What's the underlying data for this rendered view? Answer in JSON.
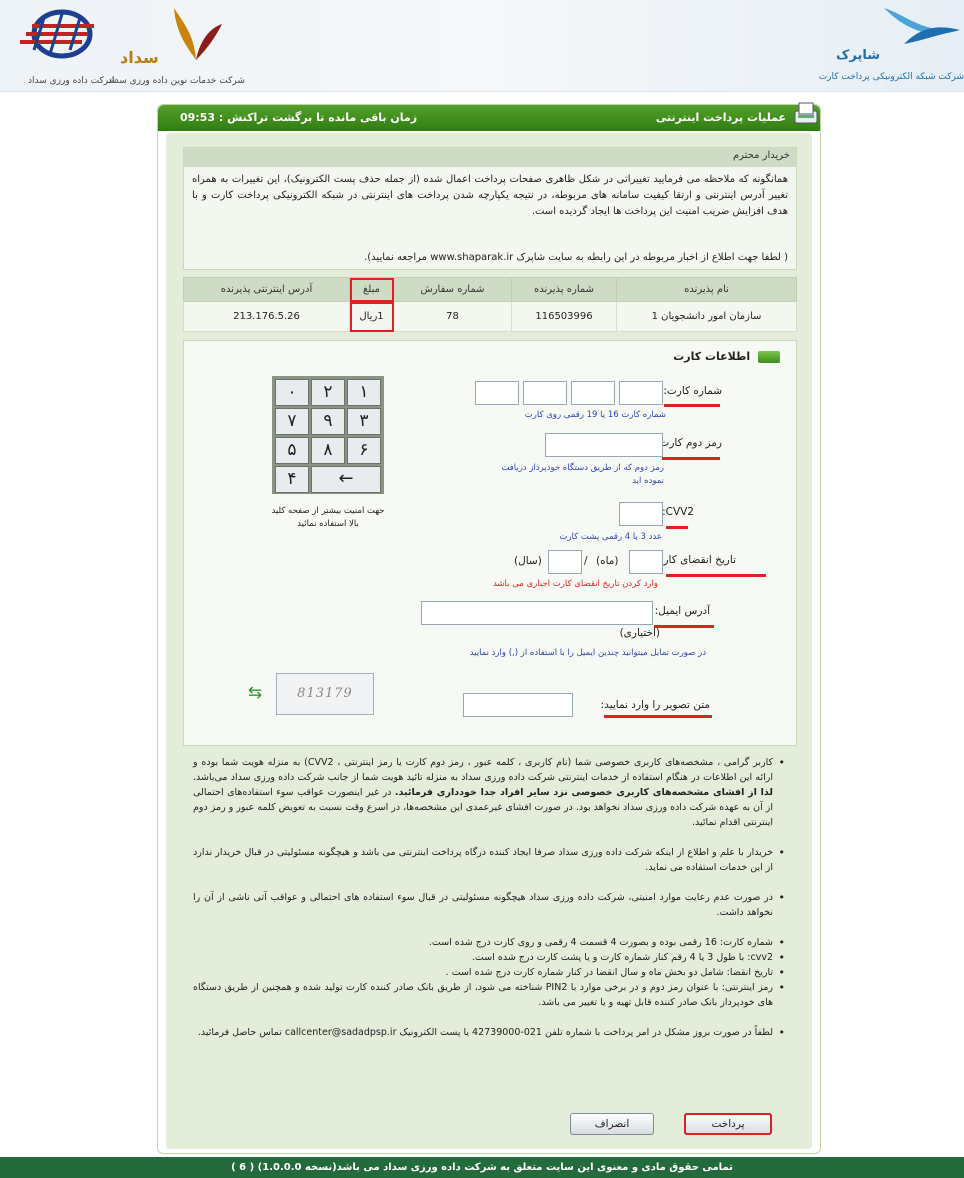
{
  "header": {
    "shaparak_name": "شاپرک",
    "shaparak_caption": "شرکت شبکه الکترونیکی پرداخت کارت",
    "sadad_name": "سداد",
    "sadad_caption": "شرکت خدمات نوین داده ورزی سداد",
    "datavarzi_caption": "شرکت داده ورزی سداد"
  },
  "topbar": {
    "title": "عملیات پرداخت اینترنتی",
    "timer_label": "زمان باقی مانده تا برگشت تراکنش :",
    "timer_value": "09:53"
  },
  "notice": {
    "heading": "خریدار محترم",
    "body": "همانگونه که ملاحظه می فرمایید تغییراتی در شکل ظاهری صفحات پرداخت اعمال شده (از جمله حذف پست الکترونیک)، این تغییرات به همراه تغییر آدرس اینترنتی و ارتقا کیفیت سامانه های مربوطه، در نتیجه یکپارچه شدن پرداخت های اینترنتی در شبکه الکترونیکی پرداخت کارت و با هدف افزایش ضریب امنیت این پرداخت ها ایجاد گردیده است.",
    "footer": "( لطفا جهت اطلاع از اخبار مربوطه در این رابطه به سایت شاپرک www.shaparak.ir مراجعه نمایید)."
  },
  "merchant_table": {
    "headers": [
      "نام پذیرنده",
      "شماره پذیرنده",
      "شماره سفارش",
      "مبلغ",
      "آدرس اینترنتی پذیرنده"
    ],
    "row": [
      "سازمان امور دانشجویان 1",
      "116503996",
      "78",
      "1ریال",
      "213.176.5.26"
    ]
  },
  "card_form": {
    "section_title": "اطلاعات کارت",
    "card_number_label": "شماره کارت:",
    "card_number_hint": "شماره کارت 16 یا 19 رقمی روی کارت",
    "pin2_label": "رمز دوم کارت:",
    "pin2_hint": "رمز دوم که از طریق دستگاه خودپرداز دریافت نموده اید",
    "cvv2_label": "CVV2:",
    "cvv2_hint": "عدد 3 یا 4 رقمی پشت کارت",
    "expiry_label": "تاریخ انقضای کارت:",
    "expiry_month": "(ماه)",
    "expiry_sep": "/",
    "expiry_year": "(سال)",
    "expiry_hint": "وارد کردن تاریخ انقضای کارت اجباری می باشد",
    "email_label": "آدرس ایمیل:",
    "email_optional": "(اختیاری)",
    "email_hint": "در صورت تمایل میتوانید چندین ایمیل را با استفاده از (,) وارد نمایید",
    "captcha_label": "متن تصویر را وارد نمایید:",
    "captcha_text": "813179",
    "keypad_keys": [
      "۱",
      "۲",
      "۰",
      "۳",
      "۹",
      "۷",
      "۶",
      "۸",
      "۵"
    ],
    "keypad_last": "۴",
    "keypad_back": "←",
    "keypad_note": "جهت امنیت بیشتر از صفحه کلید بالا استفاده نمائید"
  },
  "rules": {
    "r1_a": "کاربر گرامی ، مشخصه‌های کاربری خصوصی شما (نام کاربری ، کلمه عبور ، رمز دوم کارت یا رمز اینترنتی ، CVV2) به منزله هویت شما بوده و ارائه این اطلاعات در هنگام استفاده از خدمات اینترنتی شرکت داده ورزی سداد به منزله تائید هویت شما از جانب شرکت داده ورزی سداد می‌باشد.",
    "r1_b": "لذا از افشای مشخصه‌های کاربری خصوصی نزد سایر افراد جدا خودداری فرمائید.",
    "r1_c": "در غیر اینصورت عواقب سوء استفاده‌های احتمالی از آن به عهده شرکت داده ورزی سداد نخواهد بود. در صورت افشای غیرعمدی این مشخصه‌ها، در اسرع وقت نسبت به تعویض کلمه عبور و رمز دوم اینترنتی اقدام نمائید.",
    "r2": "خریدار با علم و اطلاع از اینکه شرکت داده ورزی سداد صرفا ایجاد کننده درگاه پرداخت اینترنتی می باشد و هیچگونه مسئولیتی در قبال خریدار ندارد از این خدمات استفاده می نماید.",
    "r3": "در صورت عدم رعایت موارد امنیتی، شرکت داده ورزی سداد هیچگونه مسئولیتی در قبال سوء استفاده های احتمالی و عواقب آتی ناشی از آن را نخواهد داشت.",
    "r4": "شماره کارت: 16 رقمی بوده و بصورت 4 قسمت 4 رقمی و روی کارت درج شده است.",
    "r5": "cvv2: با طول 3 یا 4 رقم کنار شماره کارت و یا پشت کارت درج شده است.",
    "r6": "تاریخ انقضا: شامل دو بخش ماه و سال انقضا در کنار شماره کارت درج شده است .",
    "r7": "رمز اینترنتی: با عنوان رمز دوم و در برخی موارد با PIN2 شناخته می شود، از طریق بانک صادر کننده کارت تولید شده و همچنین از طریق دستگاه های خودپرداز بانک صادر کننده قابل تهیه و یا تغییر می باشد.",
    "r8": "لطفاً در صورت بروز مشکل در امر پرداخت با شماره تلفن 021-42739000 یا پست الکترونیک callcenter@sadadpsp.ir تماس حاصل فرمائید."
  },
  "buttons": {
    "pay": "پرداخت",
    "cancel": "انصراف"
  },
  "footer": {
    "text": "تمامی حقوق مادی و معنوی این سایت متعلق به شرکت داده ورزی سداد می باشد(نسخه 1.0.0.0) ( 6 )"
  },
  "colors": {
    "accent_green": "#2f7e11",
    "panel_green": "#e3edd9",
    "footer_green": "#236b3c",
    "highlight_red": "#dd2222"
  }
}
